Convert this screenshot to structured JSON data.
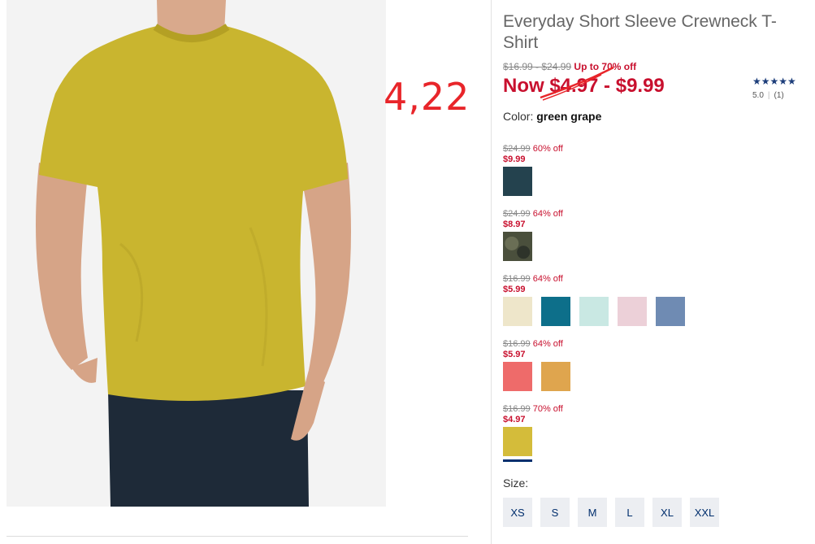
{
  "product": {
    "title": "Everyday Short Sleeve Crewneck T-Shirt",
    "original_price_range": "$16.99 - $24.99",
    "up_to_off": "Up to 70% off",
    "now_label": "Now $4.97 - $9.99",
    "color_label": "Color:",
    "color_value": "green grape"
  },
  "annotation": {
    "text": "4,22",
    "color": "#e8252a"
  },
  "rating": {
    "stars": "★★★★★",
    "score": "5.0",
    "count": "(1)"
  },
  "price_groups": [
    {
      "orig": "$24.99",
      "off": "60% off",
      "sale": "$9.99",
      "swatches": [
        "#24424e"
      ]
    },
    {
      "orig": "$24.99",
      "off": "64% off",
      "sale": "$8.97",
      "swatches": [
        "#4a4f3c"
      ]
    },
    {
      "orig": "$16.99",
      "off": "64% off",
      "sale": "$5.99",
      "swatches": [
        "#eee6ca",
        "#0d6f8a",
        "#c9e8e3",
        "#ecd0d8",
        "#6f8bb3"
      ]
    },
    {
      "orig": "$16.99",
      "off": "64% off",
      "sale": "$5.97",
      "swatches": [
        "#ee6b6a",
        "#dfa54e"
      ]
    },
    {
      "orig": "$16.99",
      "off": "70% off",
      "sale": "$4.97",
      "swatches": [
        "#d4bc3a"
      ]
    }
  ],
  "sizes": {
    "label": "Size:",
    "options": [
      "XS",
      "S",
      "M",
      "L",
      "XL",
      "XXL"
    ]
  },
  "colors": {
    "sale_red": "#c8102e",
    "navy": "#002e6d",
    "shirt": "#c9b52f"
  }
}
